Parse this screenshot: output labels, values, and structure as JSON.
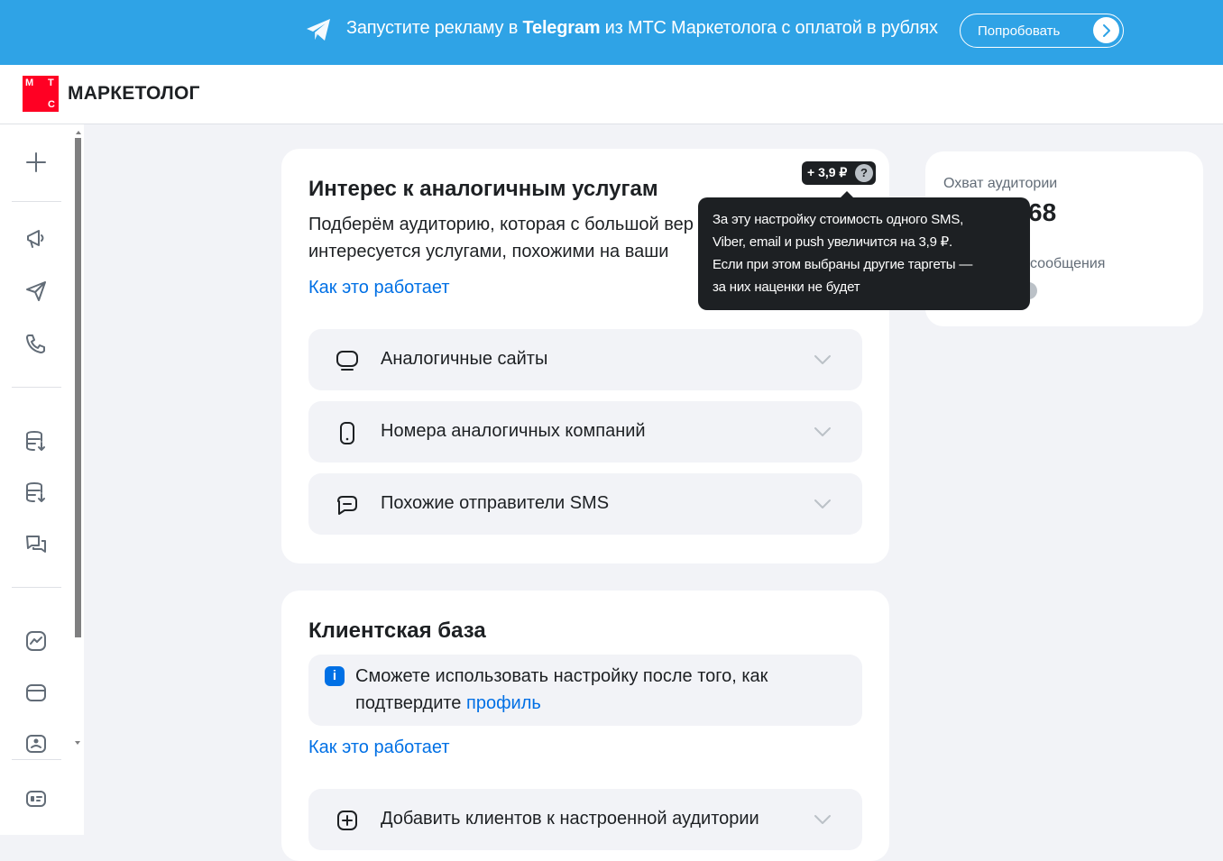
{
  "banner": {
    "text_part1": "Запустите рекламу в ",
    "text_bold": "Telegram",
    "text_part2": " из МТС Маркетолога с оплатой в рублях",
    "button_label": "Попробовать",
    "icon": "telegram-icon",
    "background_color": "#2fa3e6"
  },
  "header": {
    "logo_letters": [
      "М",
      "Т",
      "С"
    ],
    "logo_text": "МАРКЕТОЛОГ",
    "brand_color": "#ff0023"
  },
  "sidebar": {
    "icons": [
      "plus-icon",
      "megaphone-icon",
      "send-icon",
      "phone-icon",
      "database-download-icon",
      "database-download-icon",
      "chat-icon",
      "analytics-icon",
      "wallet-icon",
      "profile-icon",
      "id-card-icon"
    ]
  },
  "interest_card": {
    "title": "Интерес к аналогичным услугам",
    "description_line1": "Подберём аудиторию, которая с большой вер",
    "description_line2": "интересуется услугами, похожими на ваши",
    "how_it_works": "Как это работает",
    "price_badge": "+ 3,9 ₽",
    "help_icon_label": "?",
    "accordions": [
      {
        "label": "Аналогичные сайты",
        "icon": "monitor-icon"
      },
      {
        "label": "Номера аналогичных компаний",
        "icon": "smartphone-icon"
      },
      {
        "label": "Похожие отправители SMS",
        "icon": "message-icon"
      }
    ]
  },
  "tooltip": {
    "lines": [
      "За эту настройку стоимость одного SMS,",
      "Viber, email и push увеличится на 3,9 ₽.",
      "Если при этом выбраны другие таргеты —",
      "за них наценки не будет"
    ]
  },
  "reach_card": {
    "label": "Охват аудитории",
    "value": "68",
    "messages_label": "сообщения"
  },
  "client_base_card": {
    "title": "Клиентская база",
    "info_icon_label": "i",
    "info_text": "Сможете использовать настройку после того, как подтвердите ",
    "info_link": "профиль",
    "how_it_works": "Как это работает",
    "add_clients_label": "Добавить клиентов к настроенной аудитории",
    "add_clients_icon": "plus-square-icon"
  },
  "colors": {
    "accent_link": "#0070e5",
    "page_background": "#f2f3f7",
    "tooltip_background": "#1d2023"
  }
}
